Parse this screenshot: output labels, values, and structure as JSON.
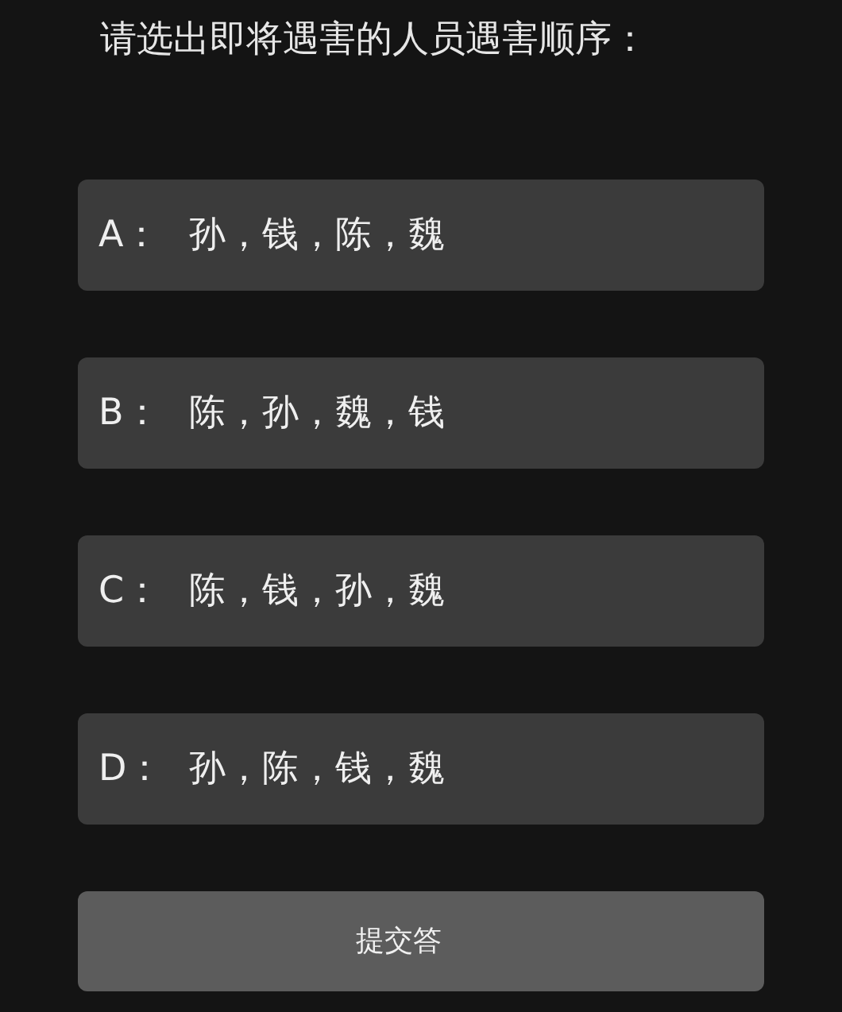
{
  "question": "请选出即将遇害的人员遇害顺序：",
  "options": [
    {
      "letter": "A：",
      "answer": "孙，钱，陈，魏",
      "selected": false
    },
    {
      "letter": "B：",
      "answer": "陈，孙，魏，钱",
      "selected": false
    },
    {
      "letter": "C：",
      "answer": "陈，钱，孙，魏",
      "selected": false
    },
    {
      "letter": "D：",
      "answer": "孙，陈，钱，魏",
      "selected": false
    }
  ],
  "submit_button": "提交答"
}
